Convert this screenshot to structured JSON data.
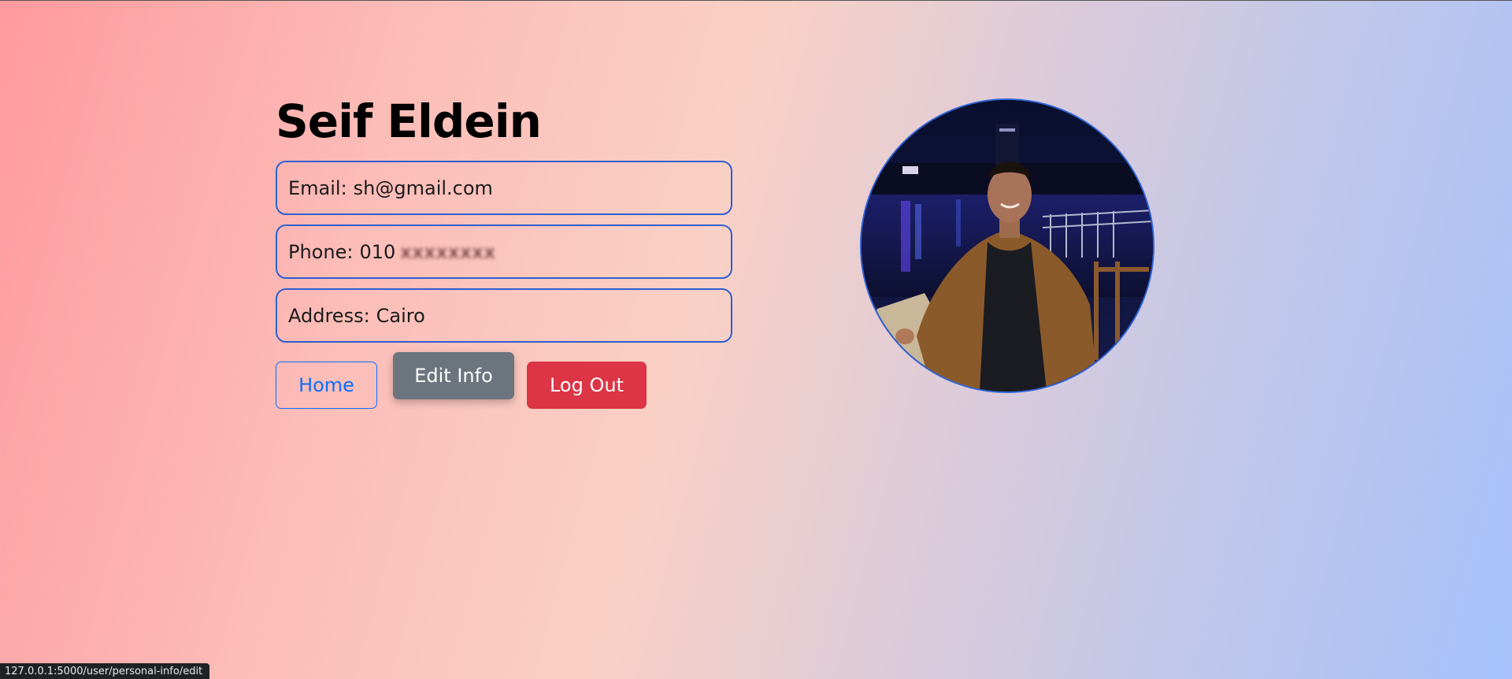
{
  "profile": {
    "name": "Seif Eldein",
    "email_label": "Email:",
    "email_value": "sh@gmail.com",
    "phone_label": "Phone:",
    "phone_value": "010",
    "phone_hidden": "xxxxxxxx",
    "address_label": "Address:",
    "address_value": "Cairo"
  },
  "actions": {
    "home_label": "Home",
    "edit_label": "Edit Info",
    "logout_label": "Log Out"
  },
  "colors": {
    "field_border": "#2f5fd0",
    "home_outline": "#0d6efd",
    "edit_bg": "#6c757d",
    "logout_bg": "#dc3545"
  },
  "status_bar": {
    "url": "127.0.0.1:5000/user/personal-info/edit"
  }
}
